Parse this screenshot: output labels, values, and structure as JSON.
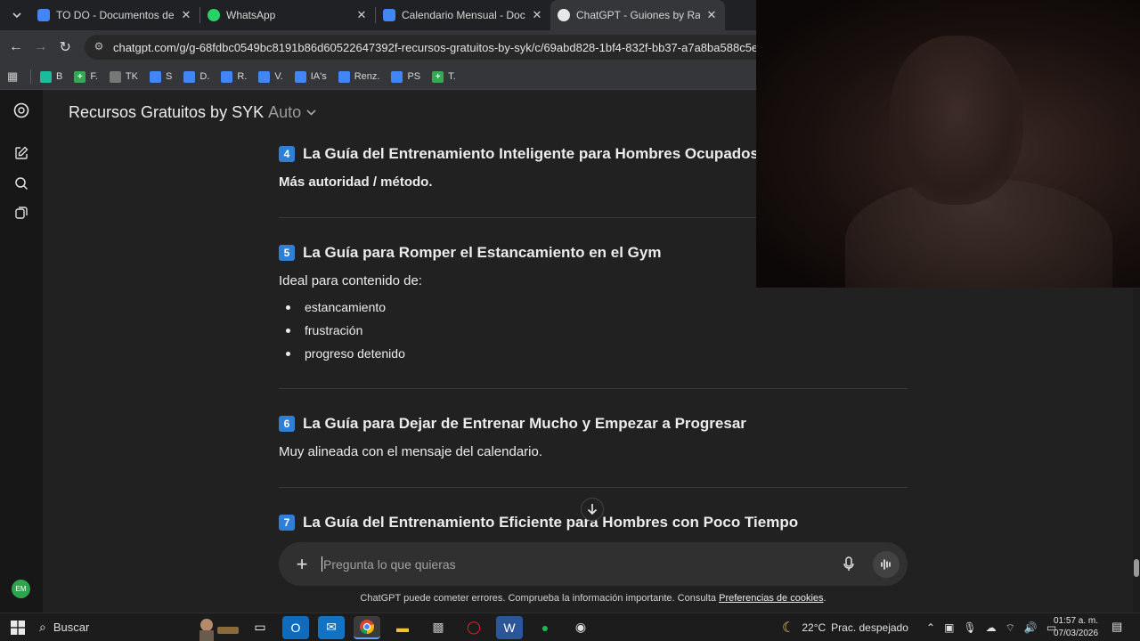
{
  "browser": {
    "tabs": [
      {
        "title": "TO DO - Documentos de Google",
        "favicon_color": "#4285f4"
      },
      {
        "title": "WhatsApp",
        "favicon_color": "#25d366"
      },
      {
        "title": "Calendario Mensual - Documentos",
        "favicon_color": "#4285f4"
      },
      {
        "title": "ChatGPT - Guiones by Rama",
        "favicon_color": "#e8e8e8"
      }
    ],
    "url": "chatgpt.com/g/g-68fdbc0549bc8191b86d60522647392f-recursos-gratuitos-by-syk/c/69abd828-1bf4-832f-bb37-a7a8ba588c5e",
    "bookmarks": [
      {
        "label": "B",
        "color": "#1abc9c"
      },
      {
        "label": "F.",
        "color": "#34a853"
      },
      {
        "label": "TK",
        "color": "#888888"
      },
      {
        "label": "S",
        "color": "#4285f4"
      },
      {
        "label": "D.",
        "color": "#4285f4"
      },
      {
        "label": "R.",
        "color": "#4285f4"
      },
      {
        "label": "V.",
        "color": "#4285f4"
      },
      {
        "label": "IA's",
        "color": "#4285f4"
      },
      {
        "label": "Renz.",
        "color": "#4285f4"
      },
      {
        "label": "PS",
        "color": "#4285f4"
      },
      {
        "label": "T.",
        "color": "#34a853"
      }
    ]
  },
  "chat": {
    "gpt_name": "Recursos Gratuitos by SYK",
    "model_label": "Auto",
    "sections": [
      {
        "num": "4",
        "title": "La Guía del Entrenamiento Inteligente para Hombres Ocupados",
        "subtitle": "Más autoridad / método."
      },
      {
        "num": "5",
        "title": "La Guía para Romper el Estancamiento en el Gym",
        "subtitle": "Ideal para contenido de:",
        "bullets": [
          "estancamiento",
          "frustración",
          "progreso detenido"
        ]
      },
      {
        "num": "6",
        "title": "La Guía para Dejar de Entrenar Mucho y Empezar a Progresar",
        "subtitle": "Muy alineada con el mensaje del calendario."
      },
      {
        "num": "7",
        "title": "La Guía del Entrenamiento Eficiente para Hombres con Poco Tiempo"
      }
    ],
    "composer_placeholder": "Pregunta lo que quieras",
    "disclaimer": "ChatGPT puede cometer errores. Comprueba la información importante. Consulta",
    "disclaimer_link": "Preferencias de cookies",
    "disclaimer_end": ".",
    "avatar_initials": "EM",
    "accent_color": "#2f7fd6"
  },
  "taskbar": {
    "search_label": "Buscar",
    "weather_temp": "22°C",
    "weather_desc": "Prac. despejado",
    "time": "01:57 a. m.",
    "date": "07/03/2026"
  }
}
